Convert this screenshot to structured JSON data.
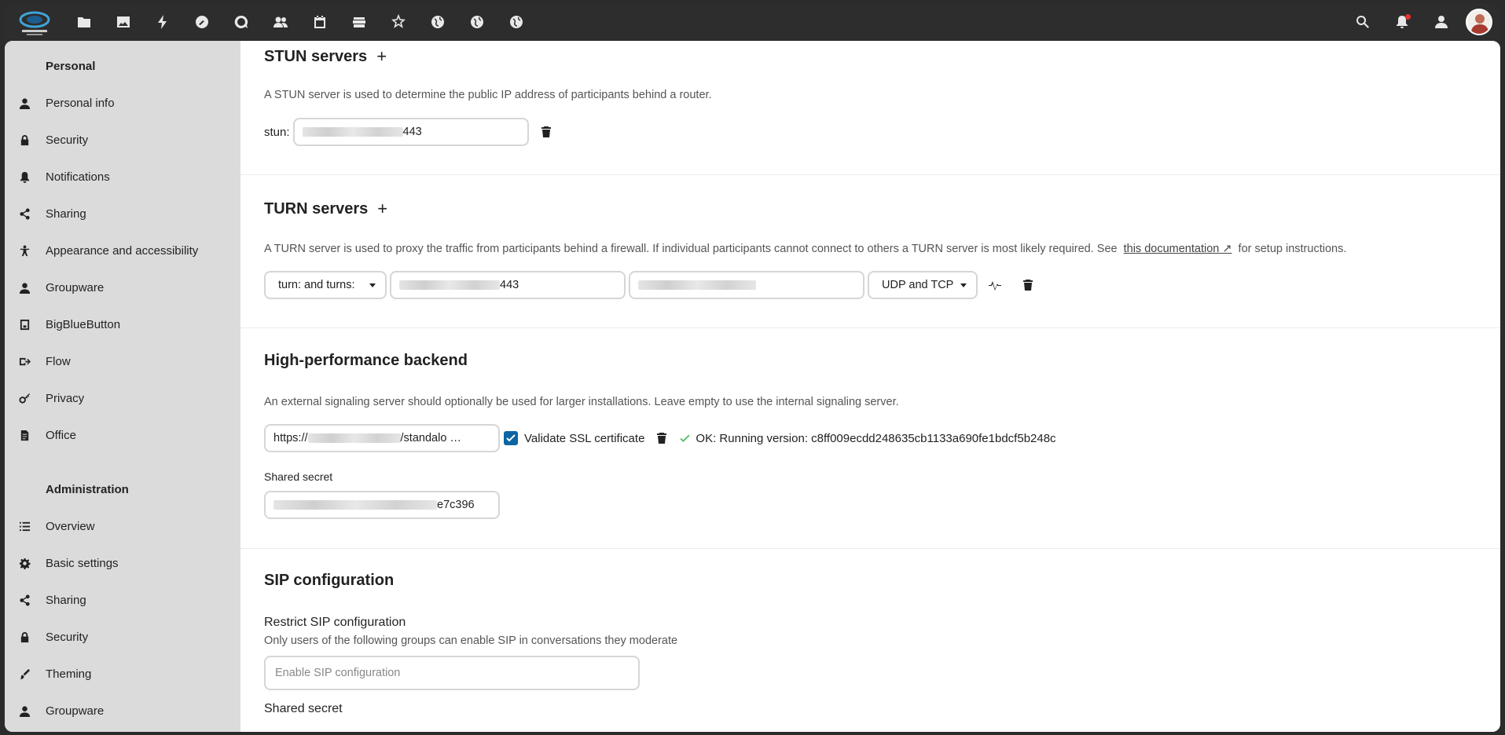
{
  "header": {
    "apps": [
      "files-icon",
      "photos-icon",
      "activity-icon",
      "tools-icon",
      "talk-icon",
      "contacts-icon",
      "calendar-icon",
      "deck-icon",
      "admin-icon",
      "globe-icon",
      "globe-icon",
      "globe-icon"
    ],
    "right": [
      "search-icon",
      "bell-icon",
      "contacts-menu-icon"
    ]
  },
  "sidebar": {
    "personal_heading": "Personal",
    "personal": [
      {
        "label": "Personal info",
        "icon": "user-icon"
      },
      {
        "label": "Security",
        "icon": "lock-icon"
      },
      {
        "label": "Notifications",
        "icon": "bell-icon"
      },
      {
        "label": "Sharing",
        "icon": "share-icon"
      },
      {
        "label": "Appearance and accessibility",
        "icon": "accessibility-icon"
      },
      {
        "label": "Groupware",
        "icon": "group-icon"
      },
      {
        "label": "BigBlueButton",
        "icon": "presentation-icon"
      },
      {
        "label": "Flow",
        "icon": "flow-icon"
      },
      {
        "label": "Privacy",
        "icon": "key-icon"
      },
      {
        "label": "Office",
        "icon": "document-icon"
      }
    ],
    "admin_heading": "Administration",
    "admin": [
      {
        "label": "Overview",
        "icon": "list-icon"
      },
      {
        "label": "Basic settings",
        "icon": "gear-icon"
      },
      {
        "label": "Sharing",
        "icon": "share-icon"
      },
      {
        "label": "Security",
        "icon": "lock-icon"
      },
      {
        "label": "Theming",
        "icon": "brush-icon"
      },
      {
        "label": "Groupware",
        "icon": "group-icon"
      }
    ]
  },
  "stun": {
    "title": "STUN servers",
    "add": "+",
    "desc": "A STUN server is used to determine the public IP address of participants behind a router.",
    "prefix": "stun:",
    "value_suffix": "443"
  },
  "turn": {
    "title": "TURN servers",
    "add": "+",
    "desc": "A TURN server is used to proxy the traffic from participants behind a firewall. If individual participants cannot connect to others a TURN server is most likely required. See",
    "link": "this documentation ↗",
    "desc_after": "for setup instructions.",
    "scheme": "turn: and turns:",
    "value_suffix": "443",
    "protocol": "UDP and TCP"
  },
  "hpb": {
    "title": "High-performance backend",
    "desc": "An external signaling server should optionally be used for larger installations. Leave empty to use the internal signaling server.",
    "url_prefix": "https://",
    "url_suffix": "/standalo …",
    "validate_label": "Validate SSL certificate",
    "status": "OK: Running version: c8ff009ecdd248635cb1133a690fe1bdcf5b248c",
    "secret_label": "Shared secret",
    "secret_suffix": "e7c396"
  },
  "sip": {
    "title": "SIP configuration",
    "restrict_title": "Restrict SIP configuration",
    "restrict_desc": "Only users of the following groups can enable SIP in conversations they moderate",
    "groups_placeholder": "Enable SIP configuration",
    "secret_label": "Shared secret"
  }
}
